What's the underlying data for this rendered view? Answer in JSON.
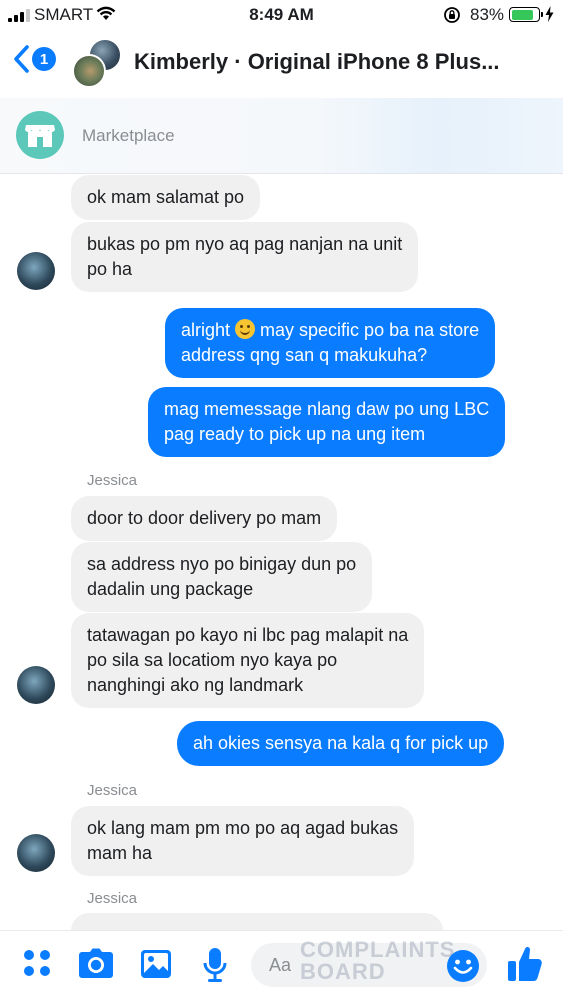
{
  "status_bar": {
    "carrier": "SMART",
    "time": "8:49 AM",
    "battery_percent": "83%",
    "battery_level": 0.83
  },
  "header": {
    "back_badge_count": "1",
    "title": "Kimberly · Original iPhone 8 Plus...",
    "accent_color": "#0a7cff"
  },
  "marketplace": {
    "label": "Marketplace",
    "icon": "storefront-icon"
  },
  "messages": [
    {
      "direction": "incoming",
      "text": "ok mam salamat po"
    },
    {
      "direction": "incoming",
      "text": "bukas po pm nyo aq pag nanjan na unit\npo ha"
    },
    {
      "direction": "outgoing",
      "text_before_emoji": "alright ",
      "emoji": "smiling-face",
      "text_after_emoji": " may specific po ba na store\naddress qng san q makukuha?"
    },
    {
      "direction": "outgoing",
      "text": "mag memessage nlang daw po ung LBC\npag ready to pick up na ung item"
    },
    {
      "direction": "sender_label",
      "text": "Jessica"
    },
    {
      "direction": "incoming",
      "text": "door to door delivery po mam"
    },
    {
      "direction": "incoming",
      "text": "sa address nyo po binigay dun po\ndadalin ung package"
    },
    {
      "direction": "incoming",
      "text": "tatawagan po kayo ni lbc pag malapit na\npo sila sa locatiom nyo kaya po\nnanghingi ako ng landmark"
    },
    {
      "direction": "outgoing",
      "text": "ah okies sensya na kala q for pick up"
    },
    {
      "direction": "sender_label",
      "text": "Jessica"
    },
    {
      "direction": "incoming",
      "text": "ok lang mam pm mo po aq agad bukas\nmam ha"
    },
    {
      "direction": "sender_label",
      "text": "Jessica"
    }
  ],
  "composer": {
    "placeholder": "Aa",
    "icons": [
      "grid-menu-icon",
      "camera-icon",
      "photo-icon",
      "microphone-icon",
      "emoji-icon",
      "thumbs-up-icon"
    ]
  },
  "watermark": {
    "line1": "COMPLAINTS",
    "line2": "BOARD"
  },
  "colors": {
    "outgoing_bubble": "#0a7cff",
    "incoming_bubble": "#f0f0f0",
    "marketplace_icon": "#5cc8b9"
  }
}
